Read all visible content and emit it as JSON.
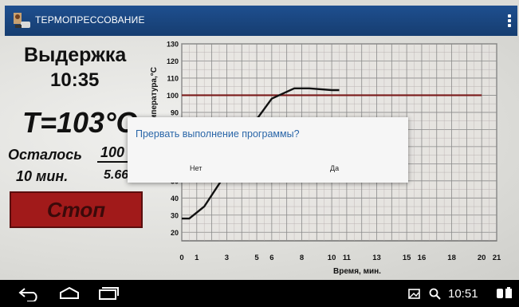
{
  "app": {
    "title": "ТЕРМОПРЕССОВАНИЕ"
  },
  "status": {
    "hold_label": "Выдержка",
    "hold_time": "10:35",
    "temperature": "T=103°C",
    "remaining_label": "Осталось",
    "remaining_value": "100",
    "remaining_time": "10 мин.",
    "extra_value": "5.66"
  },
  "controls": {
    "stop_label": "Стоп"
  },
  "dialog": {
    "message": "Прервать выполнение программы?",
    "no_label": "Нет",
    "yes_label": "Да"
  },
  "system_bar": {
    "time": "10:51"
  },
  "icons": {
    "menu": "overflow-menu-icon",
    "back": "back-icon",
    "home": "home-icon",
    "recents": "recents-icon",
    "screenshot": "screenshot-icon",
    "search": "search-icon",
    "battery": "battery-icon"
  },
  "colors": {
    "action_bar": "#1e4f8f",
    "stop_button": "#a11a1a",
    "dialog_text": "#2a66a8",
    "setpoint_line": "#7a1a1a"
  },
  "chart_data": {
    "type": "line",
    "xlabel": "Время, мин.",
    "ylabel": "Температура,°С",
    "x_ticks": [
      "0",
      "1",
      "3",
      "5",
      "6",
      "8",
      "10",
      "11",
      "13",
      "15",
      "16",
      "18",
      "20",
      "21"
    ],
    "y_ticks": [
      "20",
      "30",
      "40",
      "50",
      "60",
      "70",
      "80",
      "90",
      "100",
      "110",
      "120",
      "130"
    ],
    "xlim": [
      0,
      21
    ],
    "ylim": [
      15,
      130
    ],
    "grid": true,
    "series": [
      {
        "values_x": [
          20,
          0
        ],
        "values_y": [
          100,
          100
        ]
      },
      {
        "values_x": [
          0,
          0.5,
          1.5,
          3,
          4.5,
          6,
          7.5,
          8.5,
          10,
          10.5
        ],
        "values_y": [
          28,
          28,
          35,
          55,
          80,
          98,
          104,
          104,
          103,
          103
        ]
      }
    ]
  }
}
